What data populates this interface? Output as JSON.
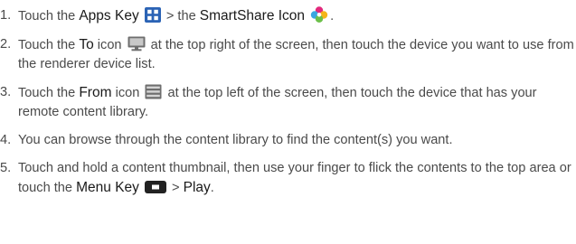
{
  "steps": [
    {
      "number": "1.",
      "parts": {
        "t1": "Touch the ",
        "apps_key": "Apps Key",
        "t2": " > the ",
        "smartshare_icon": "SmartShare Icon",
        "t3": "."
      },
      "icons": [
        "apps-grid-icon",
        "smartshare-flower-icon"
      ]
    },
    {
      "number": "2.",
      "parts": {
        "t1": "Touch the ",
        "to": "To",
        "t2": " icon ",
        "t3": " at the top right of the screen, then touch the device you want to use from the renderer device list."
      },
      "icons": [
        "monitor-icon"
      ]
    },
    {
      "number": "3.",
      "parts": {
        "t1": "Touch the ",
        "from": "From",
        "t2": " icon ",
        "t3": " at the top left of the screen, then touch the device that has your remote content library."
      },
      "icons": [
        "server-icon"
      ]
    },
    {
      "number": "4.",
      "parts": {
        "t1": "You can browse through the content library to find the content(s) you want."
      }
    },
    {
      "number": "5.",
      "parts": {
        "t1": "Touch and hold a content thumbnail, then use your finger to flick the contents to the top area or touch the ",
        "menu_key": "Menu Key",
        "t2": " > ",
        "play": "Play",
        "t3": "."
      },
      "icons": [
        "menu-key-icon"
      ]
    }
  ],
  "colors": {
    "body_text": "#4a4a4a",
    "highlight_text": "#1a1a1a",
    "apps_icon_blue": "#2b63b5",
    "monitor_icon_gray": "#6e6e6e",
    "menu_key_dark": "#222222"
  }
}
